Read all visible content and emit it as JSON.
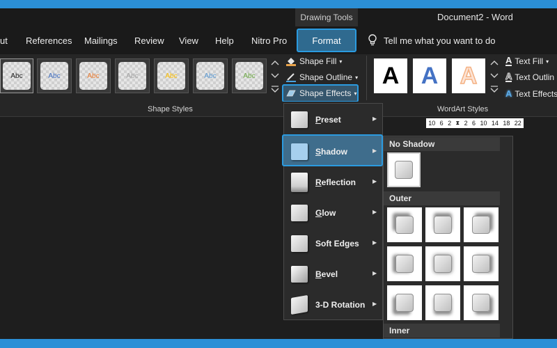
{
  "window": {
    "context_tab": "Drawing Tools",
    "title": "Document2 - Word"
  },
  "tabs": {
    "items": [
      "ut",
      "References",
      "Mailings",
      "Review",
      "View",
      "Help",
      "Nitro Pro"
    ],
    "active": "Format",
    "tell_me": "Tell me what you want to do"
  },
  "shape_styles": {
    "thumbs": [
      "Abc",
      "Abc",
      "Abc",
      "Abc",
      "Abc",
      "Abc",
      "Abc"
    ],
    "thumb_colors": [
      "#222222",
      "#4472c4",
      "#ed7d31",
      "#a5a5a5",
      "#ffc000",
      "#5b9bd5",
      "#70ad47"
    ],
    "shape_fill": "Shape Fill",
    "shape_outline": "Shape Outline",
    "shape_effects": "Shape Effects",
    "group_label": "Shape Styles"
  },
  "wordart": {
    "thumbs": [
      "A",
      "A",
      "A"
    ],
    "thumb_colors": [
      "#000000",
      "#4472c4",
      "#f4b183"
    ],
    "text_fill": "Text Fill",
    "text_outline": "Text Outlin",
    "text_effects": "Text Effects",
    "group_label": "WordArt Styles"
  },
  "ruler": {
    "ticks": [
      "10",
      "6",
      "2",
      "2",
      "6",
      "10",
      "14",
      "18",
      "22"
    ]
  },
  "effects_menu": {
    "items": [
      {
        "mnemonic": "P",
        "rest": "reset"
      },
      {
        "mnemonic": "S",
        "rest": "hadow"
      },
      {
        "mnemonic": "R",
        "rest": "eflection"
      },
      {
        "mnemonic": "G",
        "rest": "low"
      },
      {
        "mnemonic": "",
        "rest": "Soft Edges"
      },
      {
        "mnemonic": "B",
        "rest": "evel"
      },
      {
        "mnemonic": "",
        "rest": "3-D Rotation"
      }
    ],
    "highlighted": "Shadow"
  },
  "shadow_submenu": {
    "no_shadow": "No Shadow",
    "outer": "Outer",
    "inner": "Inner"
  },
  "colors": {
    "accent": "#2b9be0",
    "frame": "#2b8fd6"
  }
}
